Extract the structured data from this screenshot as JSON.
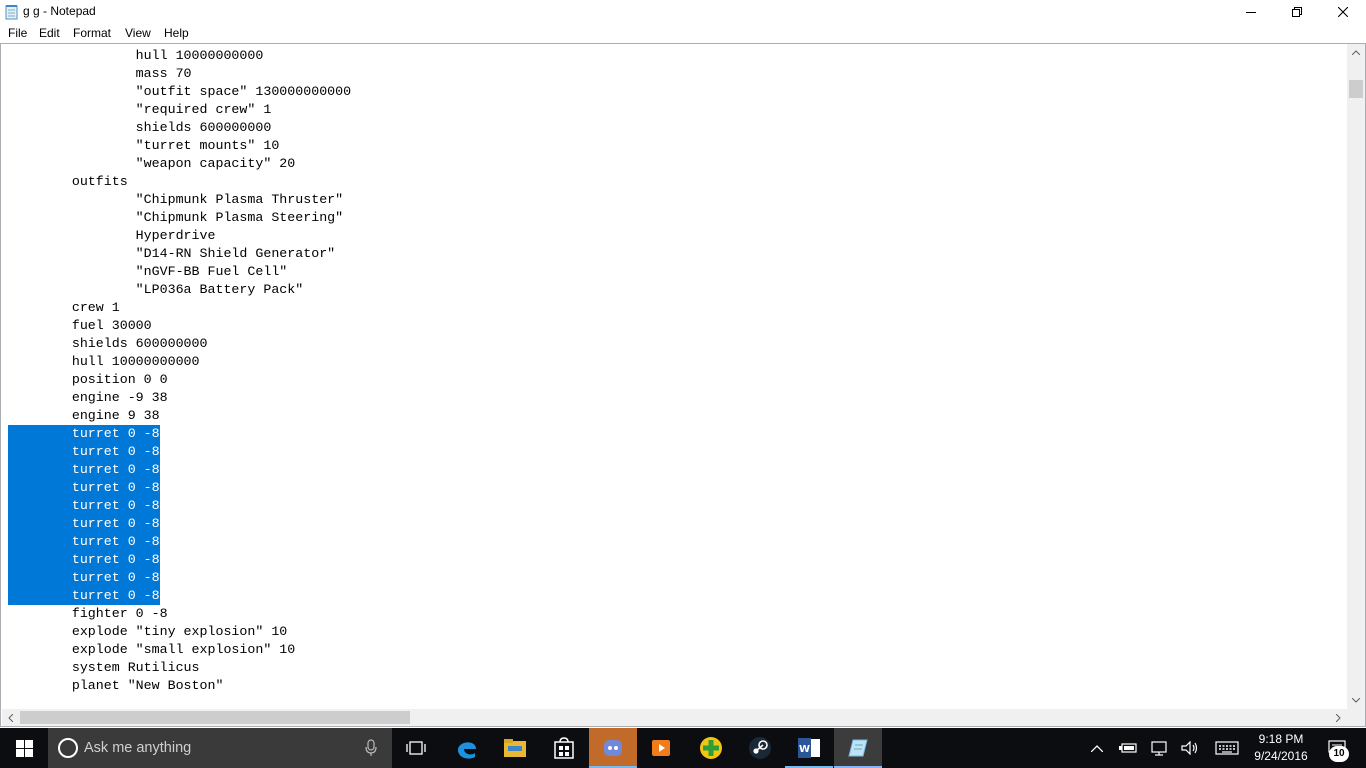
{
  "window": {
    "title": "g g - Notepad",
    "icon": "notepad-icon"
  },
  "menu": [
    "File",
    "Edit",
    "Format",
    "View",
    "Help"
  ],
  "editor": {
    "lines": [
      {
        "text": "\t\thull 10000000000",
        "selected": false
      },
      {
        "text": "\t\tmass 70",
        "selected": false
      },
      {
        "text": "\t\t\"outfit space\" 130000000000",
        "selected": false
      },
      {
        "text": "\t\t\"required crew\" 1",
        "selected": false
      },
      {
        "text": "\t\tshields 600000000",
        "selected": false
      },
      {
        "text": "\t\t\"turret mounts\" 10",
        "selected": false
      },
      {
        "text": "\t\t\"weapon capacity\" 20",
        "selected": false
      },
      {
        "text": "\toutfits",
        "selected": false
      },
      {
        "text": "\t\t\"Chipmunk Plasma Thruster\"",
        "selected": false
      },
      {
        "text": "\t\t\"Chipmunk Plasma Steering\"",
        "selected": false
      },
      {
        "text": "\t\tHyperdrive",
        "selected": false
      },
      {
        "text": "\t\t\"D14-RN Shield Generator\"",
        "selected": false
      },
      {
        "text": "\t\t\"nGVF-BB Fuel Cell\"",
        "selected": false
      },
      {
        "text": "\t\t\"LP036a Battery Pack\"",
        "selected": false
      },
      {
        "text": "\tcrew 1",
        "selected": false
      },
      {
        "text": "\tfuel 30000",
        "selected": false
      },
      {
        "text": "\tshields 600000000",
        "selected": false
      },
      {
        "text": "\thull 10000000000",
        "selected": false
      },
      {
        "text": "\tposition 0 0",
        "selected": false
      },
      {
        "text": "\tengine -9 38",
        "selected": false
      },
      {
        "text": "\tengine 9 38",
        "selected": false
      },
      {
        "text": "\tturret 0 -8",
        "selected": true
      },
      {
        "text": "\tturret 0 -8",
        "selected": true
      },
      {
        "text": "\tturret 0 -8",
        "selected": true
      },
      {
        "text": "\tturret 0 -8",
        "selected": true
      },
      {
        "text": "\tturret 0 -8",
        "selected": true
      },
      {
        "text": "\tturret 0 -8",
        "selected": true
      },
      {
        "text": "\tturret 0 -8",
        "selected": true
      },
      {
        "text": "\tturret 0 -8",
        "selected": true
      },
      {
        "text": "\tturret 0 -8",
        "selected": true
      },
      {
        "text": "\tturret 0 -8",
        "selected": true
      },
      {
        "text": "\tfighter 0 -8",
        "selected": false
      },
      {
        "text": "\texplode \"tiny explosion\" 10",
        "selected": false
      },
      {
        "text": "\texplode \"small explosion\" 10",
        "selected": false
      },
      {
        "text": "\tsystem Rutilicus",
        "selected": false
      },
      {
        "text": "\tplanet \"New Boston\"",
        "selected": false
      }
    ],
    "selection_color": "#0078d7"
  },
  "taskbar": {
    "search_placeholder": "Ask me anything",
    "pinned": [
      {
        "name": "task-view-icon"
      },
      {
        "name": "edge-icon"
      },
      {
        "name": "file-explorer-icon"
      },
      {
        "name": "store-icon"
      },
      {
        "name": "discord-icon"
      },
      {
        "name": "media-player-icon"
      },
      {
        "name": "green-plus-app-icon"
      },
      {
        "name": "steam-icon"
      },
      {
        "name": "word-icon"
      },
      {
        "name": "notepad-icon"
      }
    ],
    "clock": {
      "time": "9:18 PM",
      "date": "9/24/2016"
    },
    "notification_count": "10"
  }
}
